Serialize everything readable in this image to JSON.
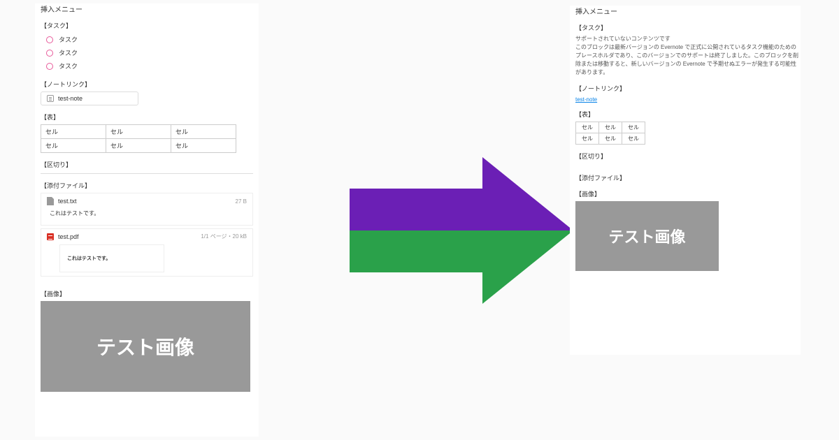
{
  "left": {
    "title": "挿入メニュー",
    "task_label": "【タスク】",
    "tasks": [
      "タスク",
      "タスク",
      "タスク"
    ],
    "notelink_label": "【ノートリンク】",
    "notelink_text": "test-note",
    "table_label": "【表】",
    "table": {
      "rows": [
        [
          "セル",
          "セル",
          "セル"
        ],
        [
          "セル",
          "セル",
          "セル"
        ]
      ]
    },
    "divider_label": "【区切り】",
    "attach_label": "【添付ファイル】",
    "attach1": {
      "name": "test.txt",
      "size": "27 B",
      "preview": "これはテストです。"
    },
    "attach2": {
      "name": "test.pdf",
      "meta": "1/1 ページ・20 kB",
      "preview": "これはテストです。"
    },
    "image_label": "【画像】",
    "image_text": "テスト画像"
  },
  "right": {
    "title": "挿入メニュー",
    "task_label": "【タスク】",
    "unsupported_line1": "サポートされていないコンテンツです",
    "unsupported_line2": "このブロックは最新バージョンの Evernote で正式に公開されているタスク機能のためのプレースホルダであり、このバージョンでのサポートは終了しました。このブロックを削除または移動すると、新しいバージョンの Evernote で予期せぬエラーが発生する可能性があります。",
    "notelink_label": "【ノートリンク】",
    "notelink_text": "test-note",
    "table_label": "【表】",
    "table": {
      "rows": [
        [
          "セル",
          "セル",
          "セル"
        ],
        [
          "セル",
          "セル",
          "セル"
        ]
      ]
    },
    "divider_label": "【区切り】",
    "attach_label": "【添付ファイル】",
    "image_label": "【画像】",
    "image_text": "テスト画像"
  },
  "arrow_colors": {
    "top": "#6b1fb5",
    "bottom": "#2aa14a"
  }
}
